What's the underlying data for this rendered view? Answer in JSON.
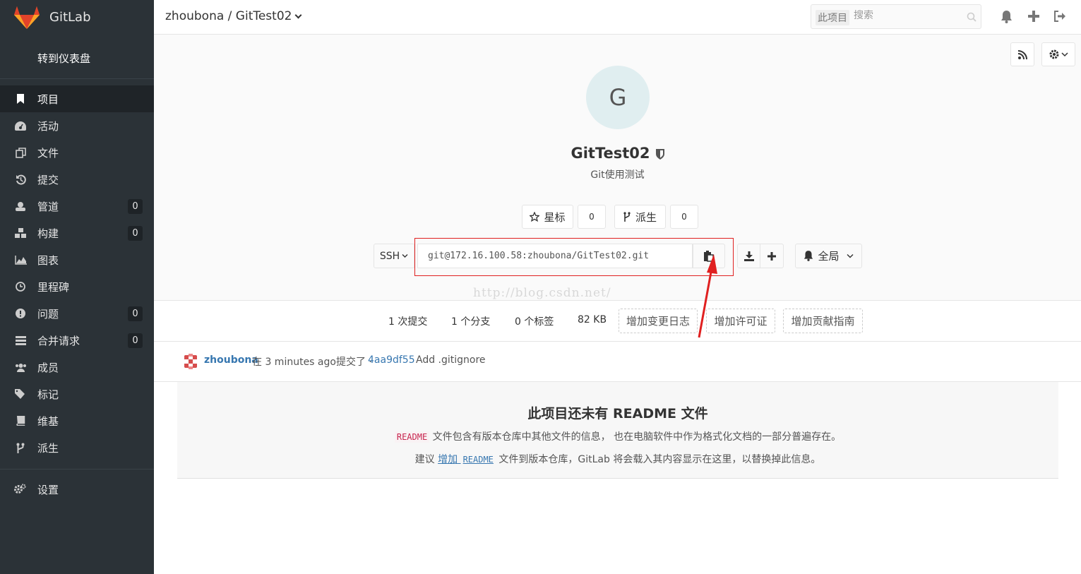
{
  "sidebar": {
    "brand": "GitLab",
    "back_to_dashboard": "转到仪表盘",
    "items": [
      {
        "label": "项目",
        "icon": "bookmark-icon",
        "active": true
      },
      {
        "label": "活动",
        "icon": "dashboard-icon"
      },
      {
        "label": "文件",
        "icon": "files-icon"
      },
      {
        "label": "提交",
        "icon": "history-icon"
      },
      {
        "label": "管道",
        "icon": "pipeline-icon",
        "count": "0"
      },
      {
        "label": "构建",
        "icon": "cubes-icon",
        "count": "0"
      },
      {
        "label": "图表",
        "icon": "area-chart-icon"
      },
      {
        "label": "里程碑",
        "icon": "clock-icon"
      },
      {
        "label": "问题",
        "icon": "exclamation-icon",
        "count": "0"
      },
      {
        "label": "合并请求",
        "icon": "tasks-icon",
        "count": "0"
      },
      {
        "label": "成员",
        "icon": "users-icon"
      },
      {
        "label": "标记",
        "icon": "tags-icon"
      },
      {
        "label": "维基",
        "icon": "book-icon"
      },
      {
        "label": "派生",
        "icon": "fork-icon"
      }
    ],
    "settings": "设置"
  },
  "header": {
    "title": "zhoubona / GitTest02",
    "search_scope": "此项目",
    "search_placeholder": "搜索"
  },
  "project": {
    "avatar_letter": "G",
    "name": "GitTest02",
    "description": "Git使用测试",
    "star_label": "星标",
    "star_count": "0",
    "fork_label": "派生",
    "fork_count": "0",
    "protocol": "SSH",
    "clone_url": "git@172.16.100.58:zhoubona/GitTest02.git",
    "notification_level": "全局",
    "watermark": "http://blog.csdn.net/"
  },
  "stats": {
    "commits": "1 次提交",
    "branches": "1 个分支",
    "tags": "0 个标签",
    "size": "82 KB",
    "add_changelog": "增加变更日志",
    "add_license": "增加许可证",
    "add_contributing": "增加贡献指南"
  },
  "commit": {
    "author": "zhoubona",
    "text": "在 3 minutes ago提交了 ·",
    "sha": "4aa9df55",
    "message": "Add .gitignore"
  },
  "readme": {
    "title": "此项目还未有 README 文件",
    "line1_code": "README",
    "line1_text": "文件包含有版本仓库中其他文件的信息， 也在电脑软件中作为格式化文档的一部分普遍存在。",
    "line2_prefix": "建议",
    "line2_link": "增加",
    "line2_link_code": "README",
    "line2_suffix": "文件到版本仓库，GitLab 将会载入其内容显示在这里，以替换掉此信息。"
  },
  "colors": {
    "sidebar_bg": "#2b3237",
    "active_bg": "#1f2428",
    "link": "#3777b0",
    "annotation_red": "#e02020",
    "gitlab_orange": "#e2432a"
  }
}
